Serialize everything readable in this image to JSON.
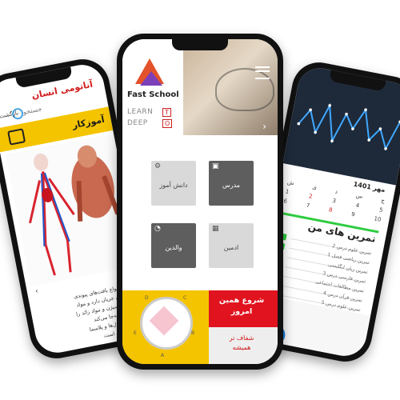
{
  "left_phone": {
    "title": "آناتومی انسان",
    "search_placeholder": "جستجو",
    "back_label": "بازگشت",
    "banner_title": "آموزکار",
    "nav_prev": "‹",
    "nav_next": "›",
    "body_lines": [
      "یکی از انواع بافت‌های پیوندی",
      "که در بدن جریان دارد و مواد",
      "غذایی، اکسیژن و مواد زائد را",
      "در بدن جابه‌جا می‌کند.",
      "خون از سلول‌ها و پلاسما",
      "تشکیل شده است."
    ]
  },
  "center_phone": {
    "brand": "Fast School",
    "slogan_left_1": "LEARN",
    "slogan_left_2": "DEEP",
    "slogan_box_1": "T",
    "slogan_box_2": "O",
    "tiles": [
      {
        "label": "دانش آموز",
        "icon": "gear-icon",
        "style": "light"
      },
      {
        "label": "مدرس",
        "icon": "book-icon",
        "style": "dark"
      },
      {
        "label": "والدین",
        "icon": "clock-icon",
        "style": "dark"
      },
      {
        "label": "ادمین",
        "icon": "grid-icon",
        "style": "light"
      }
    ],
    "cta_title_1": "شروع همین",
    "cta_title_2": "امروز",
    "cta_sub_1": "شفاف تر",
    "cta_sub_2": "همیشه",
    "radar_letters": [
      "A",
      "B",
      "C",
      "D",
      "E"
    ]
  },
  "right_phone": {
    "calendar_title": "مهر 1401",
    "calendar_rows": [
      [
        "ش",
        "ی",
        "د",
        "س",
        "چ"
      ],
      [
        "1",
        "2",
        "3",
        "4",
        "5"
      ],
      [
        "6",
        "7",
        "8",
        "9",
        "10"
      ]
    ],
    "section_title": "تمرین های من",
    "tasks": [
      "تمرین علوم درس 2",
      "تمرین ریاضی فصل 1",
      "تمرین زبان انگلیسی",
      "تمرین فارسی درس 3",
      "تمرین مطالعات اجتماعی",
      "تمرین قرآن درس 4",
      "تمرین علوم درس 5"
    ],
    "chart_points": [
      0.4,
      0.7,
      0.3,
      0.85,
      0.2,
      0.75,
      0.5,
      0.9,
      0.35,
      0.6,
      0.25,
      0.8
    ]
  },
  "colors": {
    "accent_red": "#e0131f",
    "accent_yellow": "#f5c400",
    "accent_green": "#2ecc40",
    "chart_bg": "#1e2a3a",
    "chart_line": "#3fa8ff"
  }
}
